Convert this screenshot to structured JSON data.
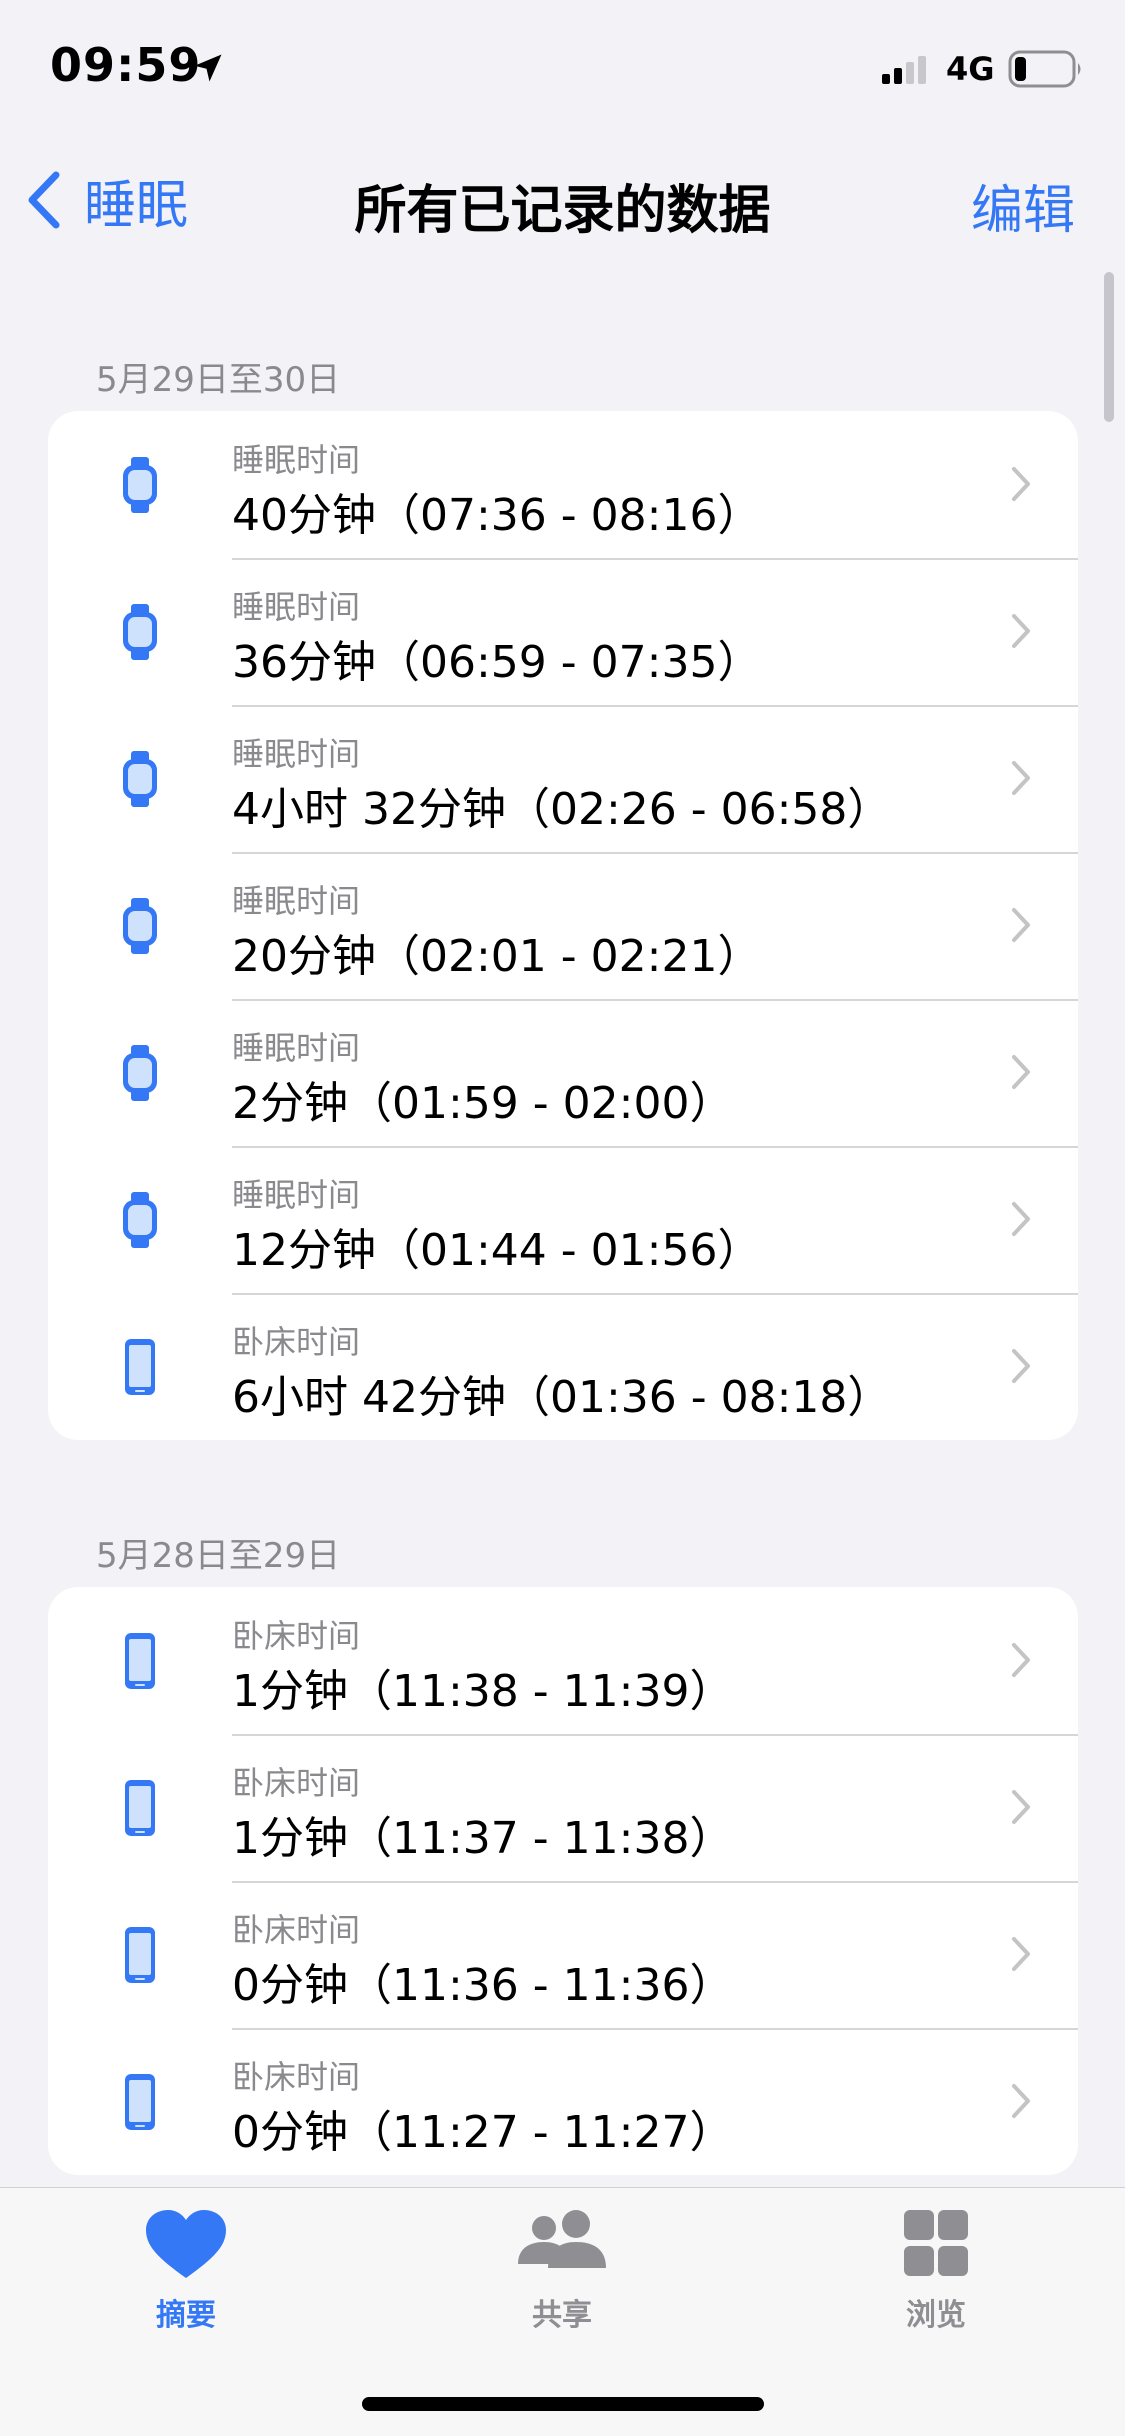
{
  "status_bar": {
    "time": "09:59",
    "network": "4G",
    "icons": [
      "location-arrow-icon",
      "signal-icon",
      "battery-icon"
    ],
    "battery_level": 0.2
  },
  "nav": {
    "back_label": "睡眠",
    "title": "所有已记录的数据",
    "edit_label": "编辑"
  },
  "sections": [
    {
      "header": "5月29日至30日",
      "rows": [
        {
          "icon": "watch-icon",
          "category": "睡眠时间",
          "value": "40分钟（07:36 - 08:16）"
        },
        {
          "icon": "watch-icon",
          "category": "睡眠时间",
          "value": "36分钟（06:59 - 07:35）"
        },
        {
          "icon": "watch-icon",
          "category": "睡眠时间",
          "value": "4小时 32分钟（02:26 - 06:58）"
        },
        {
          "icon": "watch-icon",
          "category": "睡眠时间",
          "value": "20分钟（02:01 - 02:21）"
        },
        {
          "icon": "watch-icon",
          "category": "睡眠时间",
          "value": "2分钟（01:59 - 02:00）"
        },
        {
          "icon": "watch-icon",
          "category": "睡眠时间",
          "value": "12分钟（01:44 - 01:56）"
        },
        {
          "icon": "phone-icon",
          "category": "卧床时间",
          "value": "6小时 42分钟（01:36 - 08:18）"
        }
      ]
    },
    {
      "header": "5月28日至29日",
      "rows": [
        {
          "icon": "phone-icon",
          "category": "卧床时间",
          "value": "1分钟（11:38 - 11:39）"
        },
        {
          "icon": "phone-icon",
          "category": "卧床时间",
          "value": "1分钟（11:37 - 11:38）"
        },
        {
          "icon": "phone-icon",
          "category": "卧床时间",
          "value": "0分钟（11:36 - 11:36）"
        },
        {
          "icon": "phone-icon",
          "category": "卧床时间",
          "value": "0分钟（11:27 - 11:27）"
        }
      ]
    }
  ],
  "tab_bar": {
    "tabs": [
      {
        "label": "摘要",
        "icon": "heart-icon",
        "active": true
      },
      {
        "label": "共享",
        "icon": "people-icon",
        "active": false
      },
      {
        "label": "浏览",
        "icon": "grid-icon",
        "active": false
      }
    ]
  },
  "colors": {
    "accent": "#3478f6",
    "background": "#f2f2f7",
    "secondary_text": "#8a8a8e"
  }
}
